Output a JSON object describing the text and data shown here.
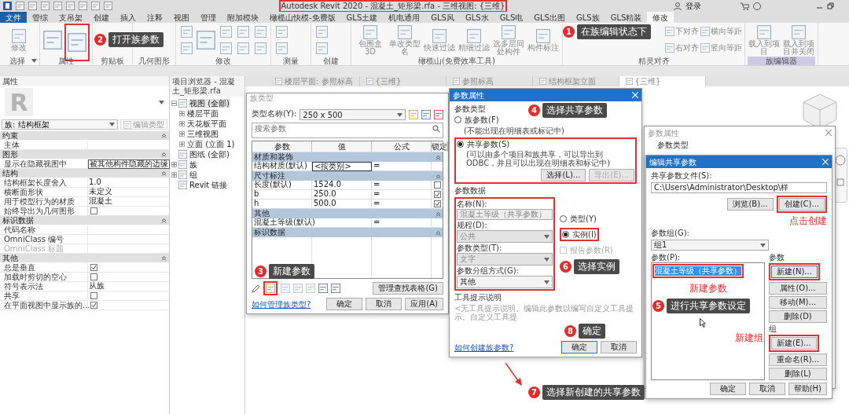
{
  "window": {
    "title": "Autodesk Revit 2020 - 混凝土_矩形梁.rfa - 三维视图: {三维}",
    "sign_in": "登录"
  },
  "menu_tabs": [
    {
      "label": "文件",
      "kind": "file",
      "selected": false
    },
    {
      "label": "管综",
      "kind": "tab",
      "selected": false
    },
    {
      "label": "支吊架",
      "kind": "tab",
      "selected": false
    },
    {
      "label": "创建",
      "kind": "tab",
      "selected": false
    },
    {
      "label": "插入",
      "kind": "tab",
      "selected": false
    },
    {
      "label": "注释",
      "kind": "tab",
      "selected": false
    },
    {
      "label": "视图",
      "kind": "tab",
      "selected": false
    },
    {
      "label": "管理",
      "kind": "tab",
      "selected": false
    },
    {
      "label": "附加模块",
      "kind": "tab",
      "selected": false
    },
    {
      "label": "橄榄山快模-免费版",
      "kind": "tab",
      "selected": false
    },
    {
      "label": "GLS土建",
      "kind": "tab",
      "selected": false
    },
    {
      "label": "机电通用",
      "kind": "tab",
      "selected": false
    },
    {
      "label": "GLS风",
      "kind": "tab",
      "selected": false
    },
    {
      "label": "GLS水",
      "kind": "tab",
      "selected": false
    },
    {
      "label": "GLS电",
      "kind": "tab",
      "selected": false
    },
    {
      "label": "GLS出图",
      "kind": "tab",
      "selected": false
    },
    {
      "label": "GLS族",
      "kind": "tab",
      "selected": false
    },
    {
      "label": "GLS精装",
      "kind": "tab",
      "selected": false
    },
    {
      "label": "修改",
      "kind": "tab",
      "selected": true
    }
  ],
  "ribbon": [
    {
      "label": "选择",
      "dropdown": true,
      "highlight": false,
      "buttons": [
        {
          "kind": "large",
          "label": "修改"
        }
      ]
    },
    {
      "label": "属性",
      "dropdown": false,
      "highlight": false,
      "buttons": [
        {
          "kind": "tall"
        },
        {
          "kind": "tall"
        }
      ]
    },
    {
      "label": "剪贴板",
      "dropdown": false,
      "highlight": false
    },
    {
      "label": "几何图形",
      "dropdown": false,
      "highlight": false
    },
    {
      "label": "修改",
      "dropdown": false,
      "highlight": false,
      "buttons": [
        {
          "kind": "icon"
        },
        {
          "kind": "icon"
        },
        {
          "kind": "tall"
        },
        {
          "kind": "icon"
        },
        {
          "kind": "icon"
        },
        {
          "kind": "icon"
        },
        {
          "kind": "icon"
        },
        {
          "kind": "icon"
        },
        {
          "kind": "icon"
        }
      ]
    },
    {
      "label": "测量",
      "dropdown": false,
      "highlight": false,
      "buttons": [
        {
          "kind": "icon"
        },
        {
          "kind": "icon"
        }
      ]
    },
    {
      "label": "创建",
      "dropdown": false,
      "highlight": false,
      "buttons": [
        {
          "kind": "icon"
        },
        {
          "kind": "icon"
        }
      ]
    },
    {
      "label": "橄榄山(免费效率工具)",
      "dropdown": false,
      "highlight": false,
      "buttons": [
        {
          "kind": "large",
          "label": "包围盒3D"
        },
        {
          "kind": "large",
          "label": "单改类型名"
        },
        {
          "kind": "large",
          "label": "快速过滤"
        },
        {
          "kind": "large",
          "label": "精细过滤"
        },
        {
          "kind": "large",
          "label": "选多层同处构件"
        },
        {
          "kind": "large",
          "label": "构件标注"
        }
      ]
    },
    {
      "label": "精灵对齐",
      "dropdown": false,
      "highlight": false,
      "buttons": [
        {
          "kind": "small",
          "label": "下对齐"
        },
        {
          "kind": "small",
          "label": "右对齐"
        },
        {
          "kind": "small",
          "label": "横向等距"
        },
        {
          "kind": "small",
          "label": "竖向等距"
        }
      ]
    },
    {
      "label": "族编辑器",
      "dropdown": false,
      "highlight": true,
      "buttons": [
        {
          "kind": "large",
          "label": "载入到项目"
        },
        {
          "kind": "large",
          "label": "载入到项目并关闭"
        }
      ]
    }
  ],
  "properties": {
    "title": "属性",
    "logo": "R",
    "type": "族: 结构框架",
    "edit_type": "编辑类型",
    "sections": [
      {
        "name": "约束",
        "rows": [
          {
            "label": "主体",
            "kind": "text",
            "disabled": false
          }
        ]
      },
      {
        "name": "图形",
        "rows": [
          {
            "label": "显示在隐藏视图中",
            "kind": "field",
            "value": "被其他构件隐藏的边缘",
            "disabled": false
          }
        ]
      },
      {
        "name": "结构",
        "rows": [
          {
            "label": "结构框架长度舍入",
            "kind": "text",
            "value": "1.0",
            "disabled": false
          },
          {
            "label": "横断面形状",
            "kind": "text",
            "value": "未定义",
            "disabled": false
          },
          {
            "label": "用于模型行为的材质",
            "kind": "text",
            "value": "混凝土",
            "disabled": false
          },
          {
            "label": "始终导出为几何图形",
            "kind": "check",
            "checked": false,
            "disabled": false
          }
        ]
      },
      {
        "name": "标识数据",
        "rows": [
          {
            "label": "代码名称",
            "kind": "text",
            "disabled": false
          },
          {
            "label": "OmniClass 编号",
            "kind": "text",
            "disabled": false
          },
          {
            "label": "OmniClass 标题",
            "kind": "text",
            "disabled": true
          }
        ]
      },
      {
        "name": "其他",
        "rows": [
          {
            "label": "总是垂直",
            "kind": "check",
            "checked": true,
            "disabled": false
          },
          {
            "label": "加载时剪切的空心",
            "kind": "check",
            "checked": false,
            "disabled": false
          },
          {
            "label": "符号表示法",
            "kind": "text",
            "value": "从族",
            "disabled": false
          },
          {
            "label": "共享",
            "kind": "check",
            "checked": false,
            "disabled": false
          },
          {
            "label": "在平面视图中显示族的...",
            "kind": "check",
            "checked": true,
            "disabled": false
          }
        ]
      }
    ]
  },
  "project_browser": {
    "title": "项目浏览器 - 混凝土_矩形梁.rfa",
    "tree": [
      {
        "label": "视图 (全部)",
        "expandable": true,
        "expanded": true,
        "selected": true,
        "children": [
          {
            "label": "楼层平面",
            "expandable": true,
            "expanded": false,
            "selected": false
          },
          {
            "label": "天花板平面",
            "expandable": true,
            "expanded": false,
            "selected": false
          },
          {
            "label": "三维视图",
            "expandable": true,
            "expanded": false,
            "selected": false
          },
          {
            "label": "立面 (立面 1)",
            "expandable": true,
            "expanded": false,
            "selected": false
          }
        ]
      },
      {
        "label": "图纸 (全部)",
        "expandable": false,
        "selected": false
      },
      {
        "label": "族",
        "expandable": true,
        "expanded": false,
        "selected": false
      },
      {
        "label": "组",
        "expandable": true,
        "expanded": false,
        "selected": false
      },
      {
        "label": "Revit 链接",
        "expandable": false,
        "selected": false
      }
    ]
  },
  "view_tabs": [
    {
      "label": "楼层平面: 参照标高",
      "selected": false
    },
    {
      "label": "{三维}",
      "selected": false
    },
    {
      "label": "参照标高",
      "selected": false
    },
    {
      "label": "结构框架立面",
      "selected": false
    },
    {
      "label": "{三维}",
      "selected": true
    }
  ],
  "family_types_dialog": {
    "title": "族类型",
    "active": false,
    "type_name_label": "类型名称(Y):",
    "type_name": "250 x 500",
    "search_placeholder": "搜索参数",
    "columns": [
      "参数",
      "值",
      "公式",
      "锁定"
    ],
    "groups": [
      {
        "name": "材质和装饰",
        "rows": [
          {
            "name": "结构材质(默认)",
            "value": "<按类别>",
            "formula": "=",
            "editing": true
          }
        ]
      },
      {
        "name": "尺寸标注",
        "rows": [
          {
            "name": "长度(默认)",
            "value": "1524.0",
            "formula": "=",
            "editing": false,
            "locked": false
          },
          {
            "name": "b",
            "value": "250.0",
            "formula": "=",
            "editing": false,
            "locked": true
          },
          {
            "name": "h",
            "value": "500.0",
            "formula": "=",
            "editing": false,
            "locked": true
          }
        ]
      },
      {
        "name": "其他",
        "rows": [
          {
            "name": "混凝土等级(默认)",
            "formula": "=",
            "editing": false
          }
        ]
      },
      {
        "name": "标识数据"
      }
    ],
    "lookup_button": "管理查找表格(G)",
    "help_link": "如何管理族类型?",
    "buttons": [
      "确定",
      "取消",
      "应用(A)"
    ]
  },
  "parameter_dialog": {
    "title": "参数属性",
    "active": true,
    "type_section": "参数类型",
    "options": [
      {
        "label": "族参数(F)",
        "note": "(不能出现在明细表或标记中)",
        "selected": false
      },
      {
        "label": "共享参数(S)",
        "note": "(可以由多个项目和族共享，可以导出到 ODBC，并且可以出现在明细表和标记中)",
        "selected": true
      }
    ],
    "select_button": {
      "label": "选择(L)...",
      "disabled": false
    },
    "export_button": {
      "label": "导出(E)...",
      "disabled": true
    },
    "data_section": "参数数据",
    "fields": [
      {
        "label": "名称(N):",
        "value": "混凝土等级（共享参数）",
        "kind": "text",
        "disabled": true
      },
      {
        "label": "规程(D):",
        "value": "公共",
        "kind": "select",
        "disabled": true
      },
      {
        "label": "参数类型(T):",
        "value": "文字",
        "kind": "select",
        "disabled": true
      },
      {
        "label": "参数分组方式(G):",
        "value": "其他",
        "kind": "select",
        "disabled": false
      }
    ],
    "scope": [
      {
        "label": "类型(Y)",
        "selected": false
      },
      {
        "label": "实例(I)",
        "selected": true
      }
    ],
    "report": {
      "label": "报告参数(R)",
      "checked": false,
      "disabled": true
    },
    "tooltip_label": "工具提示说明",
    "tooltip_text": "<无工具提示说明。编辑此参数以编写自定义工具提示。自定义工具提",
    "help_link": "如何创建族参数?",
    "buttons": [
      "确定",
      "取消"
    ]
  },
  "back_dialog": {
    "title": "参数属性",
    "active": false,
    "section": "参数类型"
  },
  "shared_dialog": {
    "title": "编辑共享参数",
    "active": true,
    "file_label": "共享参数文件(S):",
    "file_path": "C:\\Users\\Administrator\\Desktop\\样",
    "browse_button": "浏览(B)...",
    "create_button": "创建(C)...",
    "group_label": "参数组(G):",
    "group_value": "组1",
    "params_label": "参数(P):",
    "params": [
      {
        "label": "混凝土等级（共享参数）",
        "selected": true
      }
    ],
    "param_section": "参数",
    "param_buttons": [
      "新建(N)...",
      "属性(O)...",
      "移动(M)...",
      "删除(D)"
    ],
    "group_section": "组",
    "group_buttons": [
      "新建(E)...",
      "重命名(R)...",
      "删除(L)"
    ],
    "buttons": [
      "确定",
      "取消",
      "帮助(H)"
    ]
  },
  "annotations": {
    "callouts": [
      {
        "number": "1",
        "text": "在族编辑状态下"
      },
      {
        "number": "2",
        "text": "打开族参数"
      },
      {
        "number": "4",
        "text": "选择共享参数"
      },
      {
        "number": "6",
        "text": "选择实例"
      },
      {
        "number": "5",
        "text": "进行共享参数设定"
      },
      {
        "number": "3",
        "text": "新建参数"
      },
      {
        "number": "8",
        "text": "确定"
      },
      {
        "number": "7",
        "text": "选择新创建的共享参数"
      }
    ],
    "notes": [
      "点击创建",
      "新建参数",
      "新建组"
    ]
  }
}
